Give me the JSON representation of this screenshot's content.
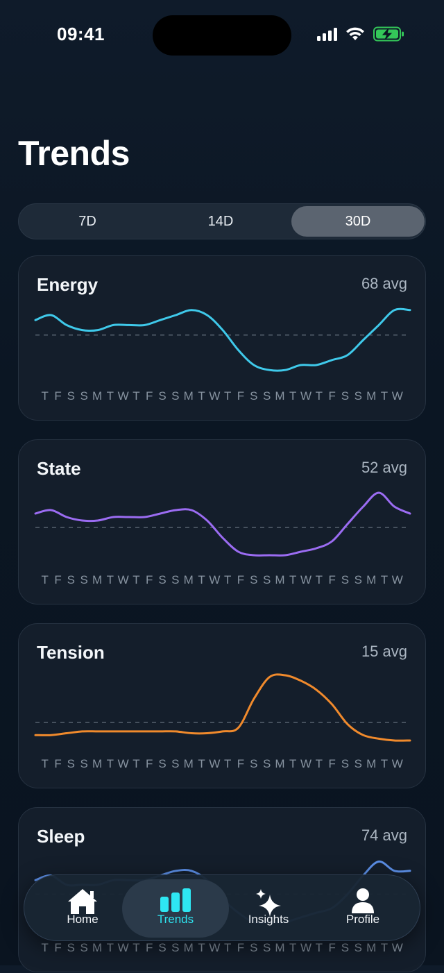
{
  "status_bar": {
    "time": "09:41",
    "icons": [
      "cellular-signal-icon",
      "wifi-icon",
      "battery-charging-icon"
    ],
    "battery_color": "#34c759"
  },
  "page_title": "Trends",
  "segments": {
    "options": [
      "7D",
      "14D",
      "30D"
    ],
    "selected": "30D"
  },
  "day_labels": [
    "T",
    "F",
    "S",
    "S",
    "M",
    "T",
    "W",
    "T",
    "F",
    "S",
    "S",
    "M",
    "T",
    "W",
    "T",
    "F",
    "S",
    "S",
    "M",
    "T",
    "W",
    "T",
    "F",
    "S",
    "S",
    "M",
    "T",
    "W"
  ],
  "cards": [
    {
      "title": "Energy",
      "avg_label": "68 avg",
      "color": "#3fc9ea",
      "avg_value": 68,
      "values": [
        71,
        72,
        70,
        69,
        69,
        70,
        70,
        70,
        71,
        72,
        73,
        72,
        69,
        65,
        62,
        61,
        61,
        62,
        62,
        63,
        64,
        67,
        70,
        73,
        73
      ]
    },
    {
      "title": "State",
      "avg_label": "52 avg",
      "color": "#9b6cf2",
      "avg_value": 52,
      "values": [
        56,
        57,
        55,
        54,
        54,
        55,
        55,
        55,
        56,
        57,
        57,
        54,
        49,
        45,
        44,
        44,
        44,
        45,
        46,
        48,
        53,
        58,
        62,
        58,
        56
      ]
    },
    {
      "title": "Tension",
      "avg_label": "15 avg",
      "color": "#f08a2c",
      "avg_value": 15,
      "values": [
        8,
        8,
        9,
        10,
        10,
        10,
        10,
        10,
        10,
        10,
        9,
        9,
        10,
        12,
        28,
        40,
        41,
        38,
        33,
        25,
        14,
        8,
        6,
        5,
        5
      ]
    },
    {
      "title": "Sleep",
      "avg_label": "74 avg",
      "color": "#5b8ee6",
      "avg_value": 74,
      "values": [
        77,
        78,
        76,
        76,
        76,
        77,
        77,
        77,
        78,
        79,
        79,
        77,
        73,
        70,
        68,
        68,
        68,
        69,
        70,
        71,
        74,
        78,
        81,
        79,
        79
      ]
    }
  ],
  "nav": {
    "items": [
      {
        "label": "Home",
        "icon": "home-icon"
      },
      {
        "label": "Trends",
        "icon": "bar-chart-icon"
      },
      {
        "label": "Insights",
        "icon": "sparkles-icon"
      },
      {
        "label": "Profile",
        "icon": "person-icon"
      }
    ],
    "active": "Trends",
    "active_color": "#2ee6f2"
  }
}
